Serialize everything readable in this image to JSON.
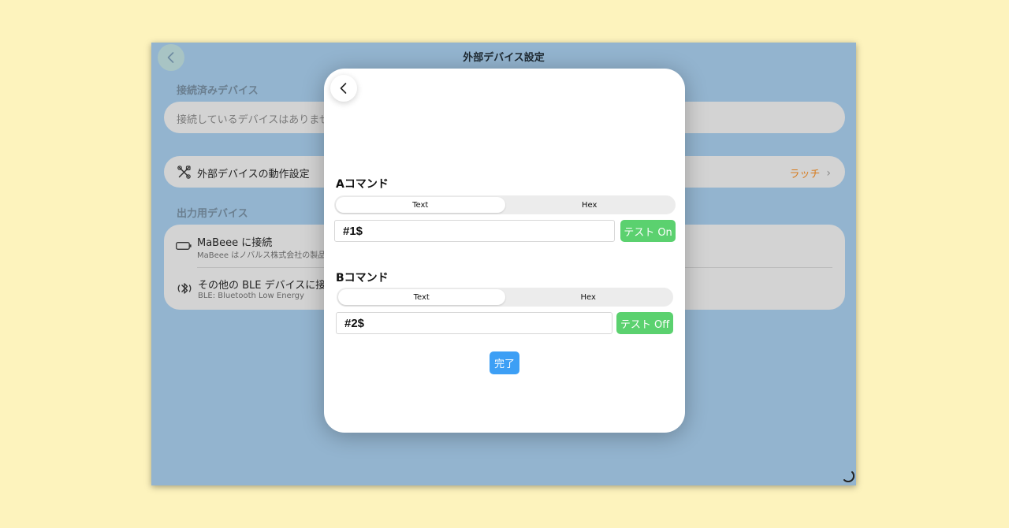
{
  "window": {
    "title": "外部デバイス設定"
  },
  "connected": {
    "section_label": "接続済みデバイス",
    "empty_text": "接続しているデバイスはありませ"
  },
  "action_settings": {
    "label": "外部デバイスの動作設定",
    "value": "ラッチ"
  },
  "output": {
    "section_label": "出力用デバイス",
    "items": [
      {
        "title": "MaBeee に接続",
        "subtitle": "MaBeee はノバルス株式会社の製品で"
      },
      {
        "title": "その他の BLE デバイスに接続",
        "subtitle": "BLE: Bluetooth Low Energy"
      }
    ]
  },
  "modal": {
    "command_a": {
      "label": "Aコマンド",
      "seg_text": "Text",
      "seg_hex": "Hex",
      "value": "#1$",
      "test_label": "テスト On"
    },
    "command_b": {
      "label": "Bコマンド",
      "seg_text": "Text",
      "seg_hex": "Hex",
      "value": "#2$",
      "test_label": "テスト Off"
    },
    "done_label": "完了"
  },
  "colors": {
    "background": "#fdf3bd",
    "window": "#93b4cf",
    "accent_orange": "#d77b1d",
    "test_green": "#5bd16f",
    "done_blue": "#3d9ff5"
  }
}
